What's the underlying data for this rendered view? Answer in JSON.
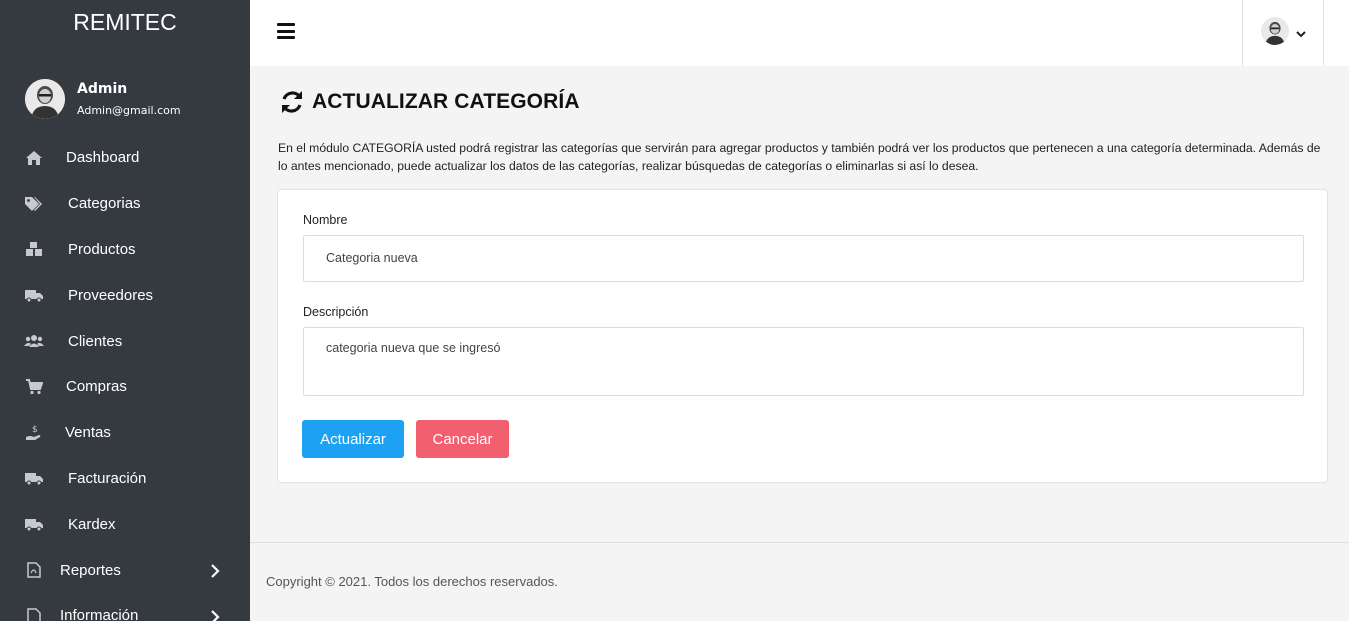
{
  "app": {
    "brand": "REMITEC"
  },
  "user": {
    "name": "Admin",
    "email": "Admin@gmail.com"
  },
  "sidebar": {
    "items": [
      {
        "label": "Dashboard",
        "icon": "home-icon"
      },
      {
        "label": "Categorias",
        "icon": "tags-icon"
      },
      {
        "label": "Productos",
        "icon": "boxes-icon"
      },
      {
        "label": "Proveedores",
        "icon": "truck-icon"
      },
      {
        "label": "Clientes",
        "icon": "users-icon"
      },
      {
        "label": "Compras",
        "icon": "cart-icon"
      },
      {
        "label": "Ventas",
        "icon": "hand-dollar-icon"
      },
      {
        "label": "Facturación",
        "icon": "truck-icon"
      },
      {
        "label": "Kardex",
        "icon": "truck-icon"
      },
      {
        "label": "Reportes",
        "icon": "file-pdf-icon"
      },
      {
        "label": "Información",
        "icon": "file-icon"
      }
    ]
  },
  "page": {
    "title": "ACTUALIZAR CATEGORÍA",
    "intro": "En el módulo CATEGORÍA usted podrá registrar las categorías que servirán para agregar productos y también podrá ver los productos que pertenecen a una categoría determinada. Además de lo antes mencionado, puede actualizar los datos de las categorías, realizar búsquedas de categorías o eliminarlas si así lo desea."
  },
  "form": {
    "name_label": "Nombre",
    "name_value": "Categoria nueva",
    "description_label": "Descripción",
    "description_value": "categoria nueva que se ingresó",
    "submit_label": "Actualizar",
    "cancel_label": "Cancelar"
  },
  "footer": {
    "text": "Copyright © 2021. Todos los derechos reservados."
  },
  "colors": {
    "sidebar_bg": "#343a40",
    "primary": "#1da1f2",
    "danger": "#f25f6f",
    "page_bg": "#f4f4f4"
  }
}
